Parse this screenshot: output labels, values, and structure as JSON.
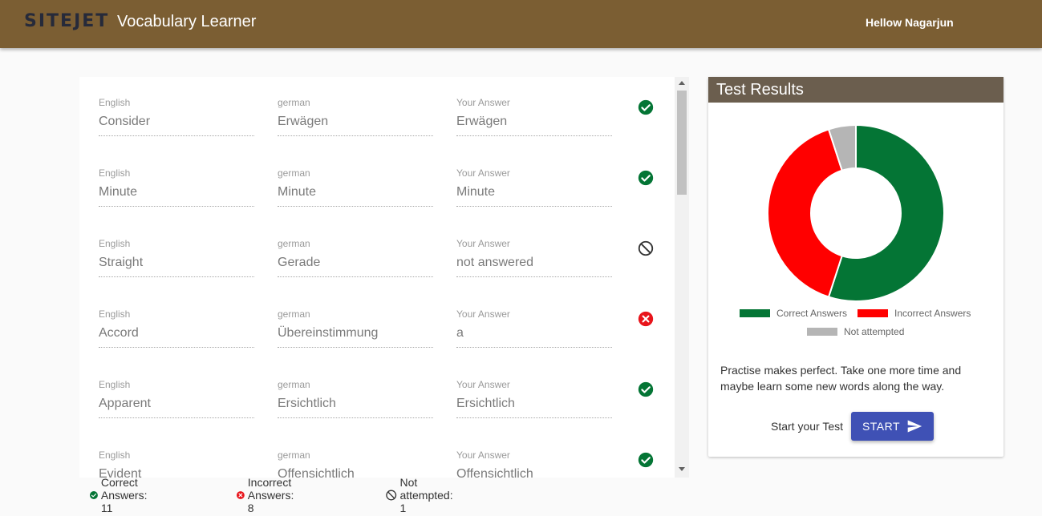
{
  "header": {
    "brand": "SITEJET",
    "title": "Vocabulary Learner",
    "greeting": "Hellow Nagarjun"
  },
  "labels": {
    "english": "English",
    "german": "german",
    "answer": "Your Answer"
  },
  "rows": [
    {
      "english": "Consider",
      "german": "Erwägen",
      "answer": "Erwägen",
      "status": "correct"
    },
    {
      "english": "Minute",
      "german": "Minute",
      "answer": "Minute",
      "status": "correct"
    },
    {
      "english": "Straight",
      "german": "Gerade",
      "answer": "not answered",
      "status": "not-attempted"
    },
    {
      "english": "Accord",
      "german": "Übereinstimmung",
      "answer": "a",
      "status": "incorrect"
    },
    {
      "english": "Apparent",
      "german": "Ersichtlich",
      "answer": "Ersichtlich",
      "status": "correct"
    },
    {
      "english": "Evident",
      "german": "Offensichtlich",
      "answer": "Offensichtlich",
      "status": "correct"
    }
  ],
  "summary": {
    "correct": "Correct Answers: 11",
    "incorrect": "Incorrect Answers: 8",
    "not_attempted": "Not attempted: 1"
  },
  "results": {
    "title": "Test Results",
    "message": "Practise makes perfect. Take one more time and maybe learn some new words along the way.",
    "start_label": "Start your Test",
    "start_button": "START"
  },
  "colors": {
    "correct": "#047535",
    "incorrect": "#ff0000",
    "not_attempted": "#b5b5b5",
    "incorrect_icon": "#e8141b",
    "primary": "#3f51b5",
    "header_bg": "#7b5e33"
  },
  "icons": {
    "correct": "check-circle-icon",
    "incorrect": "cancel-circle-icon",
    "not_attempted": "block-icon",
    "start": "send-icon"
  },
  "chart_data": {
    "type": "pie",
    "categories": [
      "Correct Answers",
      "Incorrect Answers",
      "Not attempted"
    ],
    "values": [
      11,
      8,
      1
    ],
    "legend": "bottom"
  }
}
